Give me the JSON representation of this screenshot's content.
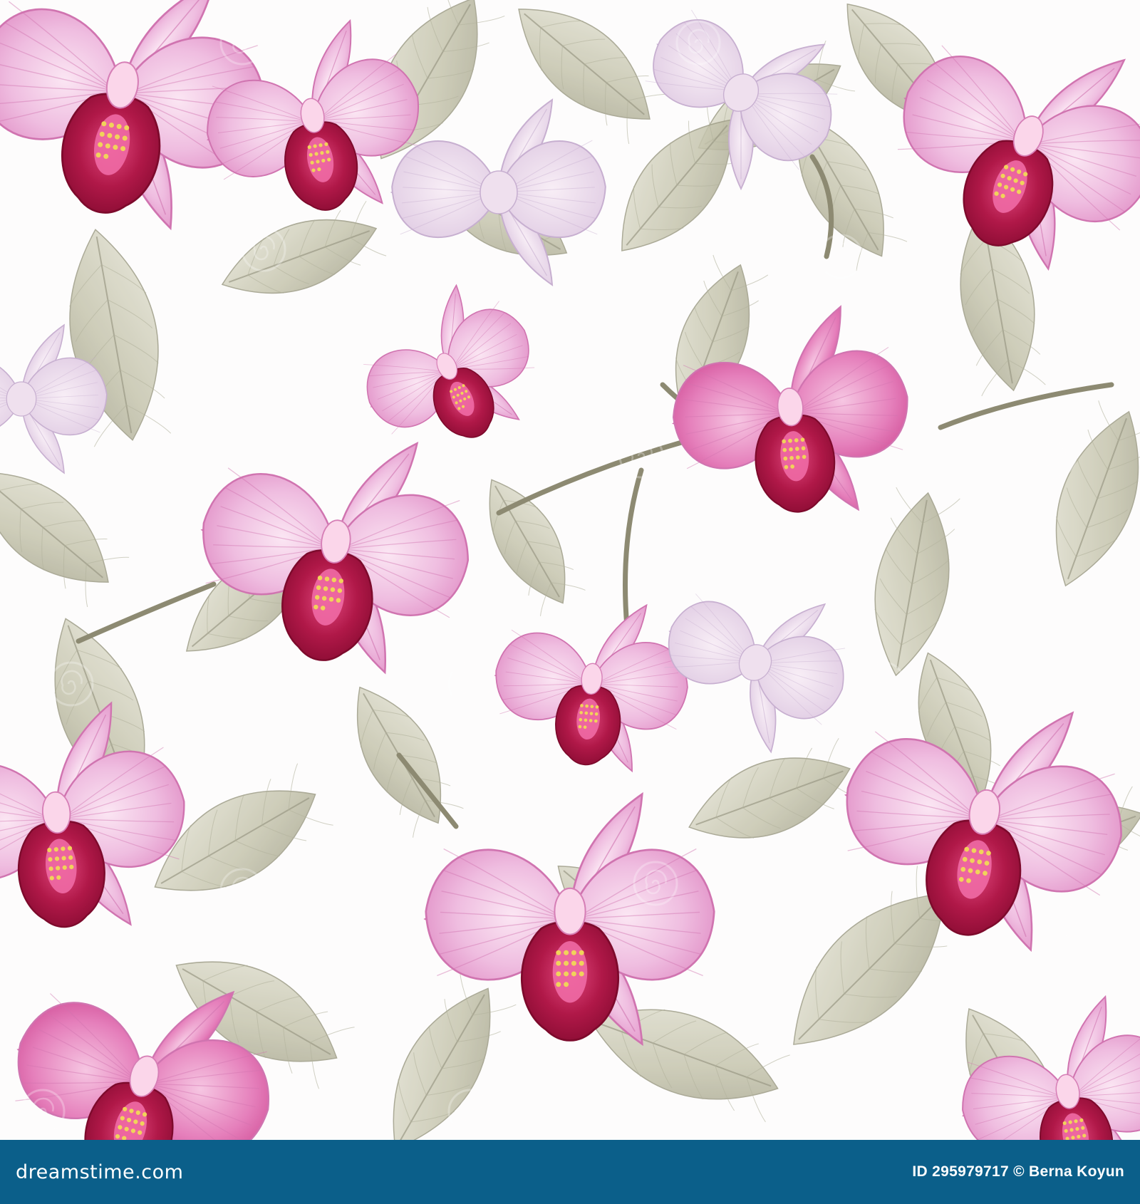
{
  "image": {
    "subject": "pink orchid floral seamless pattern",
    "background_color": "#fdfcfc",
    "colors": {
      "petal_light": "#f2c8e4",
      "petal_mid": "#e79bcc",
      "petal_deep": "#d9559c",
      "lip_crimson": "#a3123f",
      "leaf_sage": "#c9c8b4",
      "leaf_shadow": "#a9a892",
      "stem": "#8d8a72",
      "pollen_yellow": "#f1d35a"
    }
  },
  "watermark": {
    "text": "dreamstime"
  },
  "footer": {
    "brand": "dreamstime.com",
    "credit": "ID 295979717 © Berna Koyun",
    "background": "#0b5f8a"
  }
}
